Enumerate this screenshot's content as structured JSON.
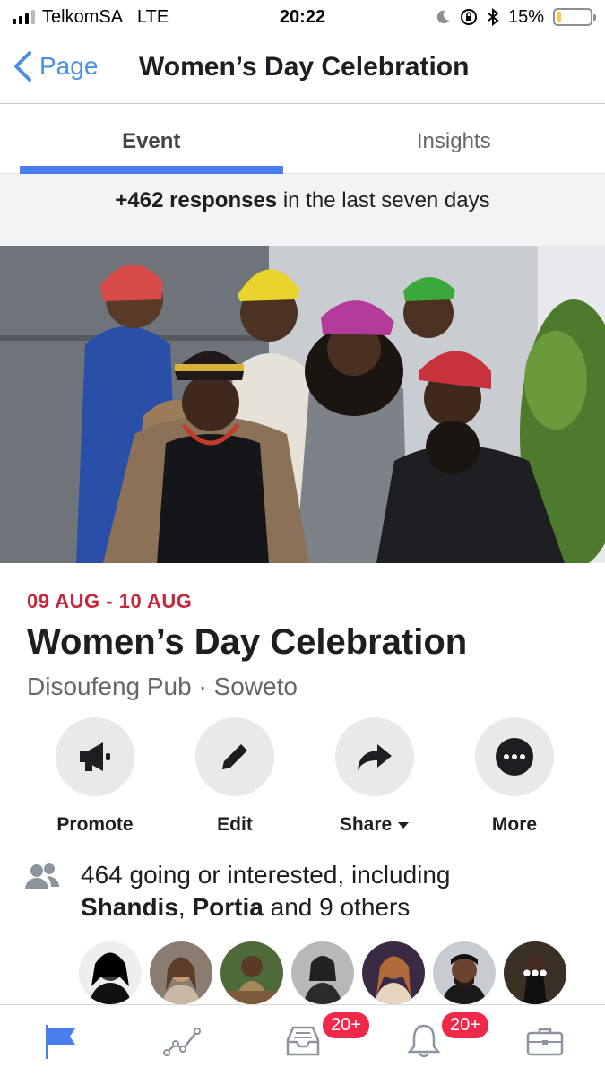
{
  "status_bar": {
    "carrier": "TelkomSA",
    "network": "LTE",
    "time": "20:22",
    "battery": "15%",
    "battery_level": 0.15
  },
  "nav": {
    "back_label": "Page",
    "title": "Women’s Day Celebration"
  },
  "tabs": [
    {
      "label": "Event",
      "active": true
    },
    {
      "label": "Insights",
      "active": false
    }
  ],
  "responses": {
    "count": "+462 responses",
    "suffix": " in the last seven days"
  },
  "event": {
    "date": "09 AUG - 10 AUG",
    "title": "Women’s Day Celebration",
    "location": "Disoufeng Pub · Soweto"
  },
  "actions": [
    {
      "label": "Promote",
      "icon": "megaphone-icon"
    },
    {
      "label": "Edit",
      "icon": "pencil-icon"
    },
    {
      "label": "Share",
      "icon": "share-arrow-icon"
    },
    {
      "label": "More",
      "icon": "more-dots-icon"
    }
  ],
  "going": {
    "line1": "464 going or interested, including",
    "name1": "Shandis",
    "sep": ", ",
    "name2": "Portia",
    "rest": " and 9 others"
  },
  "avatar_count": 7,
  "tab_bar": {
    "items": [
      {
        "icon": "flag-icon",
        "active": true
      },
      {
        "icon": "insights-graph-icon"
      },
      {
        "icon": "inbox-icon",
        "badge": "20+"
      },
      {
        "icon": "bell-icon",
        "badge": "20+"
      },
      {
        "icon": "briefcase-icon"
      }
    ]
  },
  "colors": {
    "accent": "#4a7ef0",
    "date": "#c5283d",
    "badge": "#f02849"
  }
}
